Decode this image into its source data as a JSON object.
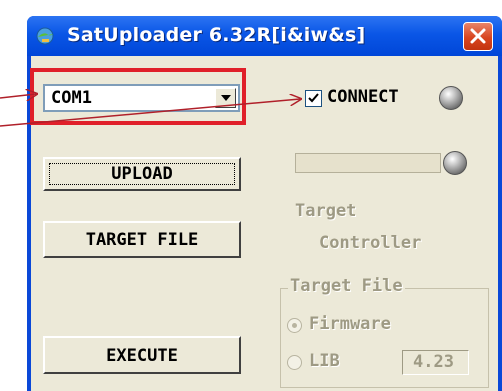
{
  "window": {
    "title": "SatUploader 6.32R[i&iw&s]"
  },
  "port": {
    "selected": "COM1"
  },
  "connect": {
    "label": "CONNECT",
    "checked": true
  },
  "buttons": {
    "upload": "UPLOAD",
    "target_file": "TARGET FILE",
    "execute": "EXECUTE"
  },
  "target_controller": {
    "line1": "Target",
    "line2": "Controller"
  },
  "target_file_group": {
    "title": "Target File",
    "option_firmware": "Firmware",
    "option_lib": "LIB",
    "lib_version": "4.23",
    "selected": "Firmware"
  },
  "icons": {
    "app": "satellite-icon",
    "close": "close-icon",
    "dropdown": "chevron-down-icon",
    "check": "check-icon",
    "led": "status-led-icon"
  },
  "colors": {
    "titlebar": "#0a56e6",
    "face": "#ece9d8",
    "annotation": "#e0202a",
    "close": "#d8451f"
  }
}
